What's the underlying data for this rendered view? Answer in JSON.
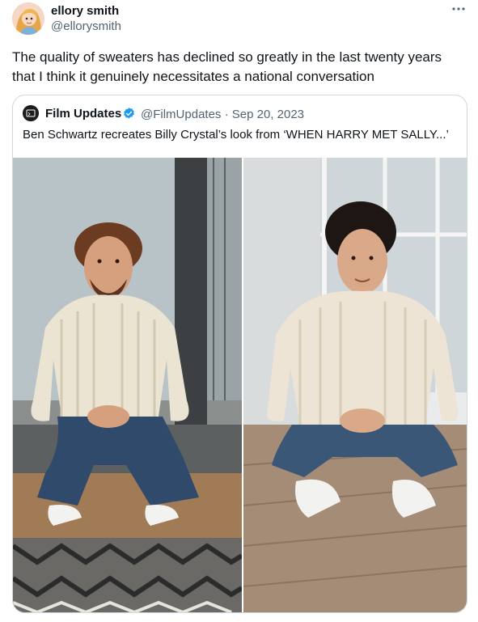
{
  "tweet": {
    "author_name": "ellory smith",
    "author_handle": "@ellorysmith",
    "more_icon": "more-horizontal-icon",
    "text": "The quality of sweaters has declined so greatly in the last twenty years that I think it genuinely necessitates a national conversation"
  },
  "quoted_tweet": {
    "author_name": "Film Updates",
    "verified_icon": "verified-badge-icon",
    "verified_color": "#1d9bf0",
    "handle": "@FilmUpdates",
    "separator": "·",
    "date": "Sep 20, 2023",
    "text": "Ben Schwartz recreates Billy Crystal’s look from ‘WHEN HARRY MET SALLY...’"
  },
  "colors": {
    "secondary_text": "#536471",
    "border": "#cfd9de"
  }
}
